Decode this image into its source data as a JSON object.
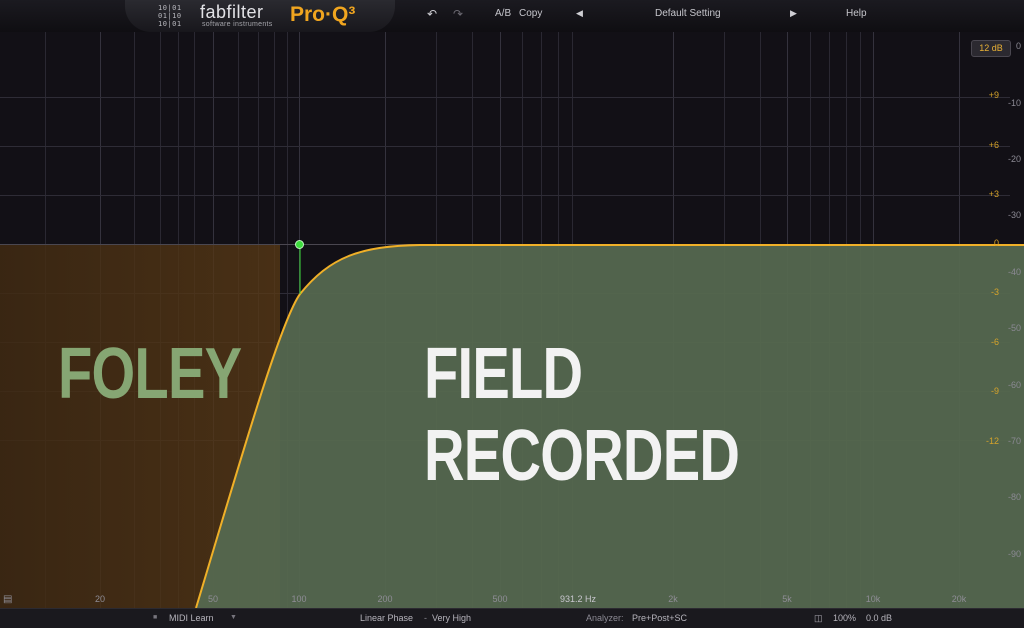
{
  "header": {
    "brand": "fabfilter",
    "brand_sub": "software instruments",
    "product": "Pro·Q³",
    "ab_label": "A/B",
    "copy_label": "Copy",
    "preset_name": "Default Setting",
    "help_label": "Help",
    "icons": {
      "undo": "undo-icon",
      "redo": "redo-icon",
      "prev": "prev-preset-icon",
      "next": "next-preset-icon"
    }
  },
  "graph": {
    "range_label": "12 dB",
    "db_scale": [
      "+9",
      "+6",
      "+3",
      "0",
      "-3",
      "-6",
      "-9",
      "-12"
    ],
    "analyzer_scale": [
      "0",
      "-10",
      "-20",
      "-30",
      "-40",
      "-50",
      "-60",
      "-70",
      "-80",
      "-90"
    ],
    "freq_labels": [
      "20",
      "50",
      "100",
      "200",
      "500",
      "931.2 Hz",
      "2k",
      "5k",
      "10k",
      "20k"
    ],
    "overlay": {
      "left_text": "FOLEY",
      "right_text": "FIELD RECORDED"
    },
    "band": {
      "type": "high-cut-low",
      "color": "#3ddc3d"
    },
    "colors": {
      "curve": "#f0b028",
      "fill": "#53654e",
      "left_tint": "#4a3416"
    }
  },
  "footer": {
    "midi_learn": "MIDI Learn",
    "phase_mode": "Linear Phase",
    "phase_quality": "Very High",
    "analyzer_label": "Analyzer:",
    "analyzer_value": "Pre+Post+SC",
    "zoom": "100%",
    "gain": "0.0 dB"
  }
}
